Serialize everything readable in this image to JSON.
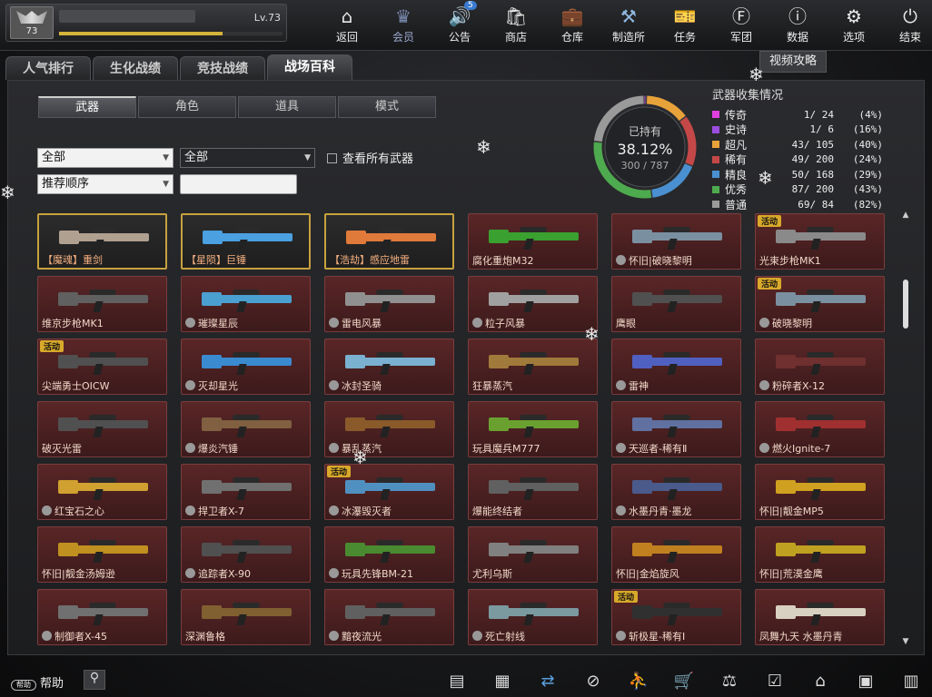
{
  "profile": {
    "rank": "73",
    "level": "Lv.73",
    "xp_fraction": 0.73
  },
  "nav": [
    {
      "label": "返回",
      "icon": "home-icon",
      "glyph": "⌂"
    },
    {
      "label": "会员",
      "icon": "crown-icon",
      "glyph": "♛",
      "active": true
    },
    {
      "label": "公告",
      "icon": "speaker-icon",
      "glyph": "🔊",
      "badge": "5"
    },
    {
      "label": "商店",
      "icon": "shop-icon",
      "glyph": "🛍"
    },
    {
      "label": "仓库",
      "icon": "briefcase-icon",
      "glyph": "💼"
    },
    {
      "label": "制造所",
      "icon": "forge-icon",
      "glyph": "⚒"
    },
    {
      "label": "任务",
      "icon": "ticket-icon",
      "glyph": "🎫"
    },
    {
      "label": "军团",
      "icon": "shield-icon",
      "glyph": "Ⓕ"
    },
    {
      "label": "数据",
      "icon": "alert-icon",
      "glyph": "ⓘ"
    },
    {
      "label": "选项",
      "icon": "gear-icon",
      "glyph": "⚙"
    },
    {
      "label": "结束",
      "icon": "power-icon",
      "glyph": "⏻"
    }
  ],
  "tabs": [
    "人气排行",
    "生化战绩",
    "竞技战绩",
    "战场百科"
  ],
  "video_btn": "视频攻略",
  "subtabs": [
    "武器",
    "角色",
    "道具",
    "模式"
  ],
  "filters": {
    "category": "全部",
    "sub": "全部",
    "sort": "推荐顺序",
    "search": "",
    "view_all": "查看所有武器"
  },
  "ownership": {
    "label": "已持有",
    "percent": "38.12%",
    "count": "300 / 787"
  },
  "collection": {
    "title": "武器收集情况",
    "rows": [
      {
        "name": "传奇",
        "count": "1/  24",
        "pct": "(4%)",
        "color": "#e040e0"
      },
      {
        "name": "史诗",
        "count": "1/   6",
        "pct": "(16%)",
        "color": "#9b4de0"
      },
      {
        "name": "超凡",
        "count": "43/ 105",
        "pct": "(40%)",
        "color": "#e8a23a"
      },
      {
        "name": "稀有",
        "count": "49/ 200",
        "pct": "(24%)",
        "color": "#c44848"
      },
      {
        "name": "精良",
        "count": "50/ 168",
        "pct": "(29%)",
        "color": "#4a90d0"
      },
      {
        "name": "优秀",
        "count": "87/ 200",
        "pct": "(43%)",
        "color": "#4eaa4e"
      },
      {
        "name": "普通",
        "count": "69/  84",
        "pct": "(82%)",
        "color": "#9a9a9a"
      }
    ]
  },
  "ring_segments": [
    {
      "color": "#e040e0",
      "value": 1
    },
    {
      "color": "#9b4de0",
      "value": 1
    },
    {
      "color": "#e8a23a",
      "value": 43
    },
    {
      "color": "#c44848",
      "value": 49
    },
    {
      "color": "#4a90d0",
      "value": 50
    },
    {
      "color": "#4eaa4e",
      "value": 87
    },
    {
      "color": "#9a9a9a",
      "value": 69
    }
  ],
  "weapons": [
    {
      "name": "【魔魂】重剑",
      "gold": true,
      "owned": false,
      "color": "#b0a090"
    },
    {
      "name": "【星陨】巨锤",
      "gold": true,
      "owned": false,
      "color": "#4aa0e0"
    },
    {
      "name": "【浩劫】感应地雷",
      "gold": true,
      "owned": false,
      "color": "#e07a3a"
    },
    {
      "name": "腐化重炮M32",
      "color": "#3aa030"
    },
    {
      "name": "怀旧|破晓黎明",
      "owned": true,
      "color": "#7a90a0"
    },
    {
      "name": "光束步枪MK1",
      "tag": "活动",
      "color": "#8a8a8a"
    },
    {
      "name": "维京步枪MK1",
      "color": "#606060"
    },
    {
      "name": "璀璨星辰",
      "owned": true,
      "color": "#4aa0d0"
    },
    {
      "name": "雷电风暴",
      "owned": true,
      "color": "#909090"
    },
    {
      "name": "粒子风暴",
      "owned": true,
      "color": "#a0a0a0"
    },
    {
      "name": "鹰眼",
      "color": "#505050"
    },
    {
      "name": "破晓黎明",
      "owned": true,
      "tag": "活动",
      "color": "#7a90a0"
    },
    {
      "name": "尖端勇士OICW",
      "tag": "活动",
      "color": "#505050"
    },
    {
      "name": "灭却星光",
      "owned": true,
      "color": "#3a8ad0"
    },
    {
      "name": "冰封圣骑",
      "owned": true,
      "color": "#7ab0d0"
    },
    {
      "name": "狂暴蒸汽",
      "color": "#a07a3a"
    },
    {
      "name": "雷神",
      "owned": true,
      "color": "#5060c0"
    },
    {
      "name": "粉碎者X-12",
      "owned": true,
      "color": "#703030"
    },
    {
      "name": "破灭光雷",
      "color": "#505050"
    },
    {
      "name": "爆炎汽锤",
      "owned": true,
      "color": "#806040"
    },
    {
      "name": "暴乱蒸汽",
      "owned": true,
      "color": "#8a5a2a"
    },
    {
      "name": "玩具魔兵M777",
      "color": "#6aa030"
    },
    {
      "name": "天巡者-稀有Ⅱ",
      "owned": true,
      "color": "#6070a0"
    },
    {
      "name": "燃火Ignite-7",
      "owned": true,
      "color": "#a03030"
    },
    {
      "name": "红宝石之心",
      "owned": true,
      "color": "#d0a030"
    },
    {
      "name": "捍卫者X-7",
      "owned": true,
      "color": "#707070"
    },
    {
      "name": "冰瀑毁灭者",
      "owned": true,
      "tag": "活动",
      "color": "#5090c0"
    },
    {
      "name": "爆能终结者",
      "color": "#606060"
    },
    {
      "name": "水墨丹青·墨龙",
      "owned": true,
      "color": "#4a5a8a"
    },
    {
      "name": "怀旧|靓金MP5",
      "color": "#d0a020"
    },
    {
      "name": "怀旧|靓金汤姆逊",
      "color": "#c09020"
    },
    {
      "name": "追踪者X-90",
      "owned": true,
      "color": "#505050"
    },
    {
      "name": "玩具先锋BM-21",
      "owned": true,
      "color": "#4a8a30"
    },
    {
      "name": "尤利乌斯",
      "color": "#808080"
    },
    {
      "name": "怀旧|金焰旋风",
      "color": "#c08020"
    },
    {
      "name": "怀旧|荒漠金鹰",
      "color": "#c0a020"
    },
    {
      "name": "制御者X-45",
      "owned": true,
      "color": "#707070"
    },
    {
      "name": "深渊鲁格",
      "color": "#806030"
    },
    {
      "name": "黯夜流光",
      "owned": true,
      "color": "#606060"
    },
    {
      "name": "死亡射线",
      "owned": true,
      "color": "#7a9aa0"
    },
    {
      "name": "斩极星-稀有Ⅰ",
      "owned": true,
      "tag": "活动",
      "color": "#303030"
    },
    {
      "name": "凤舞九天 水墨丹青",
      "color": "#d8d0c0"
    }
  ],
  "bottom": {
    "help_key": "帮助",
    "help": "帮助",
    "tools": [
      {
        "icon": "film-icon",
        "glyph": "▤"
      },
      {
        "icon": "calendar-icon",
        "glyph": "▦"
      },
      {
        "icon": "refresh-icon",
        "glyph": "⇄",
        "active": true
      },
      {
        "icon": "compass-icon",
        "glyph": "⊘"
      },
      {
        "icon": "runner-icon",
        "glyph": "⛹"
      },
      {
        "icon": "cart-icon",
        "glyph": "🛒"
      },
      {
        "icon": "scale-icon",
        "glyph": "⚖"
      },
      {
        "icon": "checklist-icon",
        "glyph": "☑"
      },
      {
        "icon": "house-icon",
        "glyph": "⌂"
      },
      {
        "icon": "calendar-check-icon",
        "glyph": "▣"
      },
      {
        "icon": "screen-icon",
        "glyph": "▥"
      }
    ]
  }
}
